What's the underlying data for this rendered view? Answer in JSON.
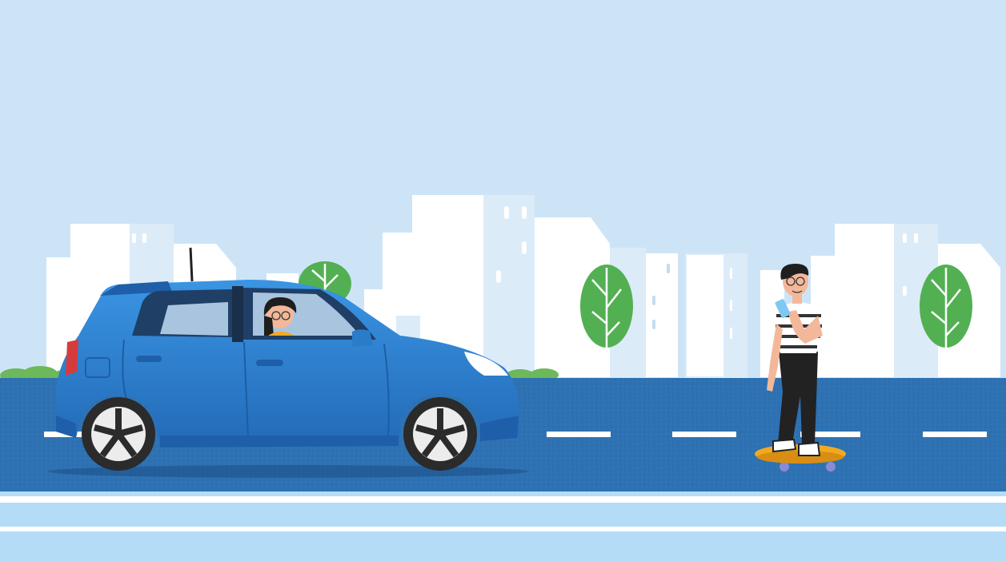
{
  "scene": {
    "description_hidden": "",
    "colors": {
      "sky": "#cde4f6",
      "building_white": "#ffffff",
      "building_light": "#dcebf8",
      "window": "#c2dcf2",
      "tree": "#52b052",
      "road": "#2e72b3",
      "road_line": "#ffffff",
      "sidewalk": "#b4dcf7",
      "grass": "#6cb85a",
      "car_body": "#2f86d6",
      "car_dark": "#1f5ea8",
      "tire": "#2b2b2b",
      "skateboard": "#f2a91f",
      "shirt_stripe": "#333333",
      "pants": "#222222",
      "skin": "#f3b89a",
      "hair": "#1e1e1e"
    },
    "objects": [
      "city-skyline",
      "trees",
      "road",
      "blue-hatchback-car",
      "driver",
      "skateboarder-with-phone"
    ]
  }
}
